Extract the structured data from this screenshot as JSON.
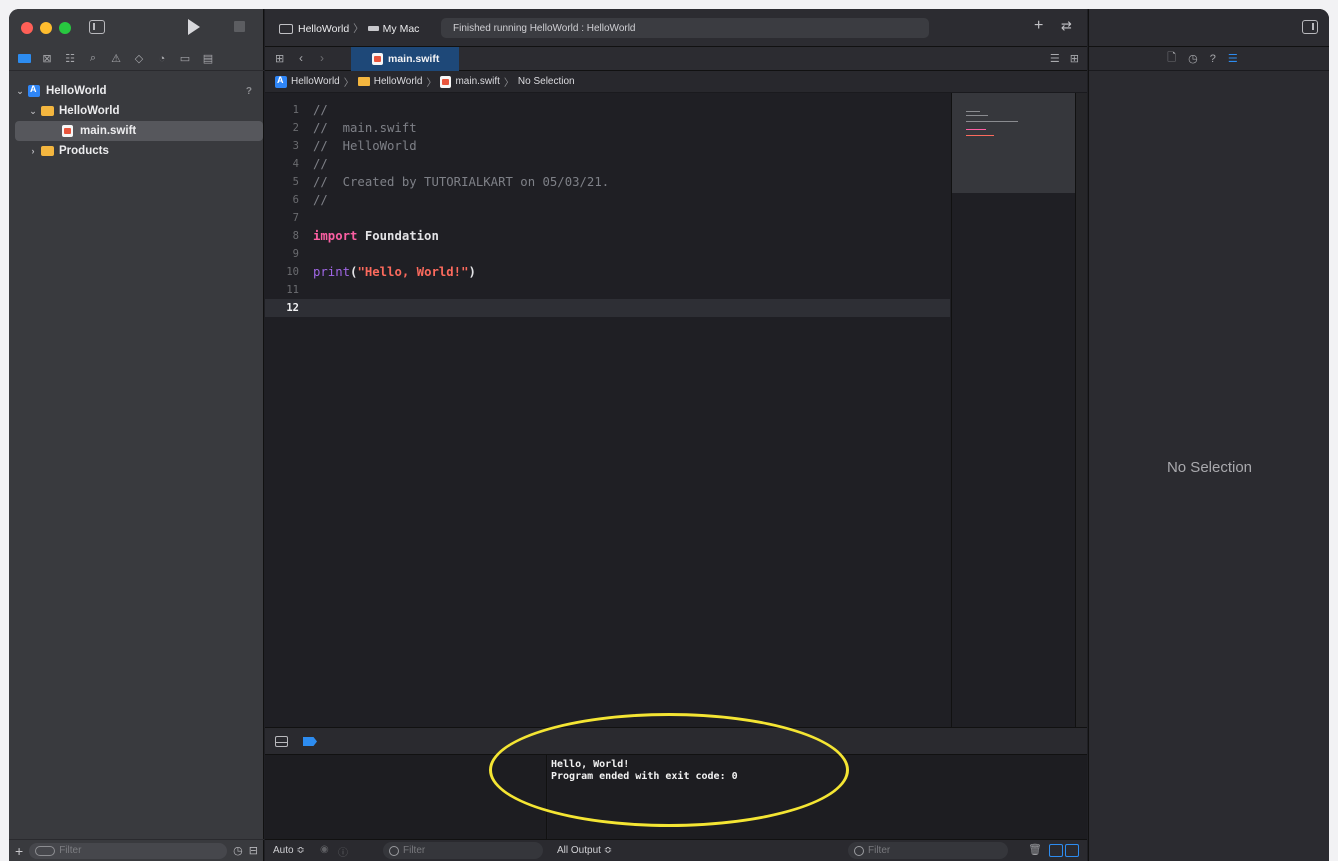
{
  "toolbar": {
    "scheme_project": "HelloWorld",
    "scheme_target": "My Mac",
    "activity_status": "Finished running HelloWorld : HelloWorld",
    "add_label": "+",
    "swap_label": "⇄"
  },
  "navigator": {
    "project": {
      "name": "HelloWorld",
      "badge": "?"
    },
    "group": "HelloWorld",
    "file": "main.swift",
    "products": "Products",
    "filter_placeholder": "Filter"
  },
  "editor": {
    "tab_label": "main.swift",
    "breadcrumb": [
      "HelloWorld",
      "HelloWorld",
      "main.swift",
      "No Selection"
    ],
    "lines": [
      {
        "n": "1",
        "text": "//"
      },
      {
        "n": "2",
        "text": "//  main.swift"
      },
      {
        "n": "3",
        "text": "//  HelloWorld"
      },
      {
        "n": "4",
        "text": "//"
      },
      {
        "n": "5",
        "text": "//  Created by TUTORIALKART on 05/03/21."
      },
      {
        "n": "6",
        "text": "//"
      },
      {
        "n": "7",
        "text": ""
      },
      {
        "n": "8",
        "kw": "import",
        "rest": " Foundation"
      },
      {
        "n": "9",
        "text": ""
      },
      {
        "n": "10",
        "fn": "print",
        "open": "(",
        "str": "\"Hello, World!\"",
        "close": ")"
      },
      {
        "n": "11",
        "text": ""
      },
      {
        "n": "12",
        "text": ""
      }
    ],
    "current_line": "12"
  },
  "debug": {
    "auto_label": "Auto ≎",
    "vars_filter_placeholder": "Filter",
    "output_selector": "All Output ≎",
    "console_filter_placeholder": "Filter",
    "console_lines": [
      "Hello, World!",
      "Program ended with exit code: 0"
    ]
  },
  "inspector": {
    "placeholder": "No Selection"
  },
  "colors": {
    "keyword": "#fc5fa3",
    "function": "#a167e6",
    "string": "#fc6a5d",
    "comment": "#7e8087",
    "accent": "#2d8cf0",
    "annotation": "#f4e533"
  }
}
